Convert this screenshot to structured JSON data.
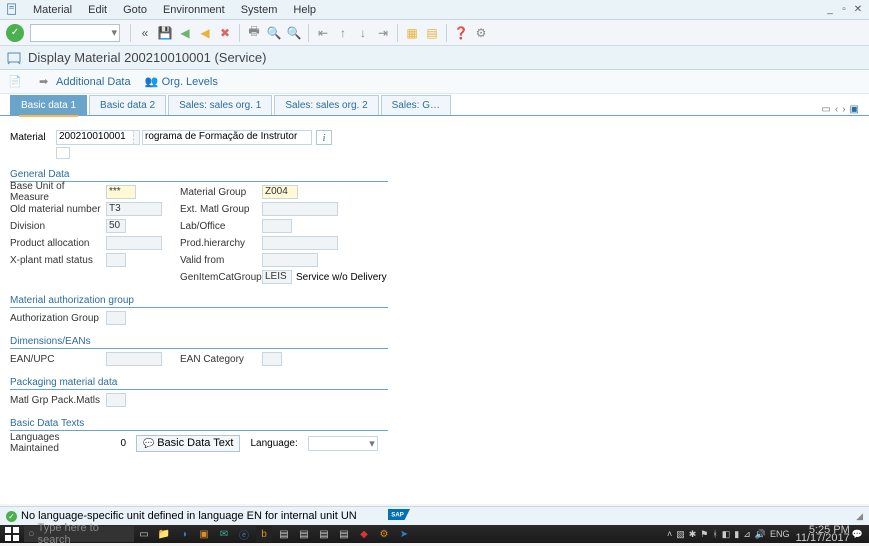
{
  "menubar": {
    "items": [
      "Material",
      "Edit",
      "Goto",
      "Environment",
      "System",
      "Help"
    ]
  },
  "window": {
    "title": "Display Material 200210010001 (Service)"
  },
  "toolbar2": {
    "additional": "Additional Data",
    "orglevels": "Org. Levels"
  },
  "tabs": [
    "Basic data 1",
    "Basic data 2",
    "Sales: sales org. 1",
    "Sales: sales org. 2",
    "Sales: G…"
  ],
  "material": {
    "label": "Material",
    "number": "200210010001",
    "desc": "rograma de Formação de Instrutor"
  },
  "general": {
    "header": "General Data",
    "base_uom_lbl": "Base Unit of Measure",
    "base_uom": "***",
    "matgrp_lbl": "Material Group",
    "matgrp": "Z004",
    "oldmat_lbl": "Old material number",
    "oldmat": "T3",
    "extmat_lbl": "Ext. Matl Group",
    "div_lbl": "Division",
    "div": "50",
    "lab_lbl": "Lab/Office",
    "prodalloc_lbl": "Product allocation",
    "prodhier_lbl": "Prod.hierarchy",
    "xplant_lbl": "X-plant matl status",
    "validfrom_lbl": "Valid from",
    "genitem_lbl": "GenItemCatGroup",
    "genitem": "LEIS",
    "genitem_txt": "Service w/o Delivery"
  },
  "auth": {
    "header": "Material authorization group",
    "grp_lbl": "Authorization Group"
  },
  "dims": {
    "header": "Dimensions/EANs",
    "ean_lbl": "EAN/UPC",
    "eancat_lbl": "EAN Category"
  },
  "pack": {
    "header": "Packaging material data",
    "lbl": "Matl Grp Pack.Matls"
  },
  "texts": {
    "header": "Basic Data Texts",
    "langmaint_lbl": "Languages Maintained",
    "langmaint": "0",
    "btn": "Basic Data Text",
    "lang_lbl": "Language:"
  },
  "status": {
    "msg": "No language-specific unit defined in language EN for internal unit UN"
  },
  "taskbar": {
    "search": "Type here to search",
    "lang": "ENG",
    "time": "5:25 PM",
    "date": "11/17/2017"
  }
}
